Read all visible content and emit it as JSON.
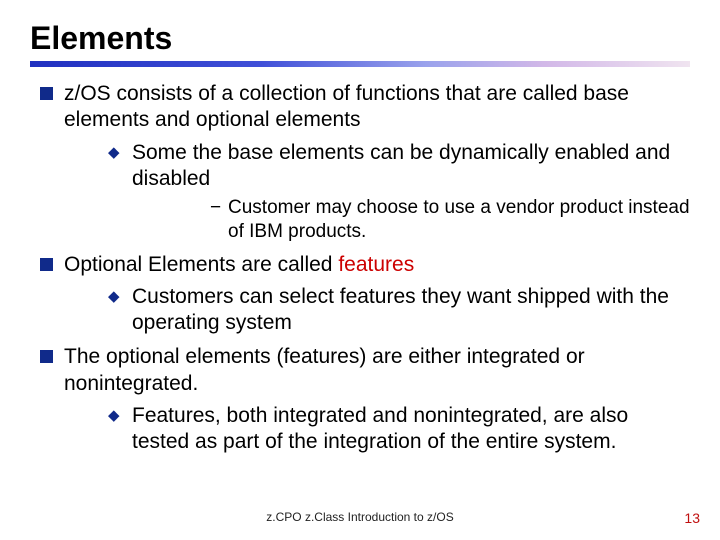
{
  "title": "Elements",
  "bullets": {
    "b1": "z/OS consists of a collection of functions that are called base elements and optional elements",
    "b1_1": "Some the base elements can be dynamically enabled and disabled",
    "b1_1_1": "Customer may choose to use a vendor product instead of IBM products.",
    "b2_pre": "Optional Elements are called ",
    "b2_red": "features",
    "b2_1": "Customers can select features they want shipped with the operating system",
    "b3": "The optional elements (features) are either integrated or nonintegrated.",
    "b3_1": "Features, both integrated and nonintegrated, are also tested as part of the integration of the entire system."
  },
  "footer": "z.CPO z.Class  Introduction to z/OS",
  "page": "13"
}
